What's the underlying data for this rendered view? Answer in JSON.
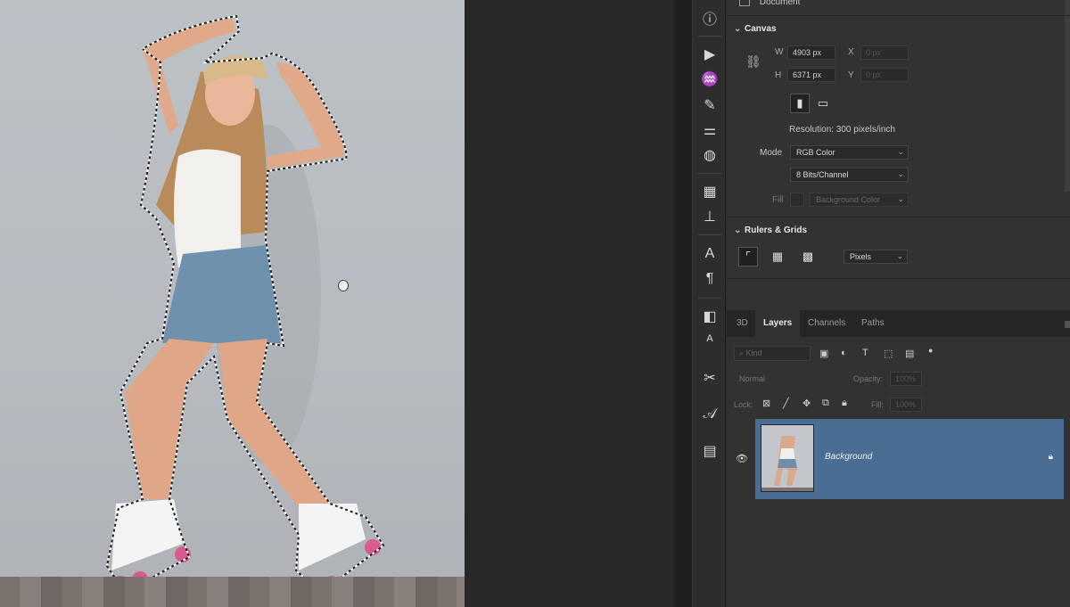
{
  "properties": {
    "document_label": "Document",
    "canvas_title": "Canvas",
    "width_label": "W",
    "width_value": "4903 px",
    "height_label": "H",
    "height_value": "6371 px",
    "x_label": "X",
    "x_value": "0 px",
    "y_label": "Y",
    "y_value": "0 px",
    "resolution_text": "Resolution: 300 pixels/inch",
    "mode_label": "Mode",
    "mode_value": "RGB Color",
    "depth_value": "8 Bits/Channel",
    "fill_label": "Fill",
    "fill_value": "Background Color",
    "rulers_title": "Rulers & Grids",
    "units_value": "Pixels"
  },
  "layers_panel": {
    "tabs": [
      "3D",
      "Layers",
      "Channels",
      "Paths"
    ],
    "active_tab": "Layers",
    "kind_label": "Kind",
    "blend_mode": "Normal",
    "opacity_label": "Opacity:",
    "opacity_value": "100%",
    "lock_label": "Lock:",
    "fill_label": "Fill:",
    "fill_value": "100%",
    "layers": [
      {
        "name": "Background",
        "visible": true,
        "locked": true
      }
    ]
  },
  "tools": [
    "info-icon",
    "play-icon",
    "brush-settings-icon",
    "brush-icon",
    "adjustments-icon",
    "color-palette-icon",
    "table-icon",
    "stamp-icon",
    "character-icon",
    "paragraph-icon",
    "glyphs-icon",
    "type-tool-icon",
    "cut-icon",
    "glyph-a-icon",
    "grid-icon"
  ],
  "colors": {
    "panel_bg": "#323232",
    "selected_layer": "#4a6e93",
    "canvas_bg": "#bcc1c6"
  }
}
